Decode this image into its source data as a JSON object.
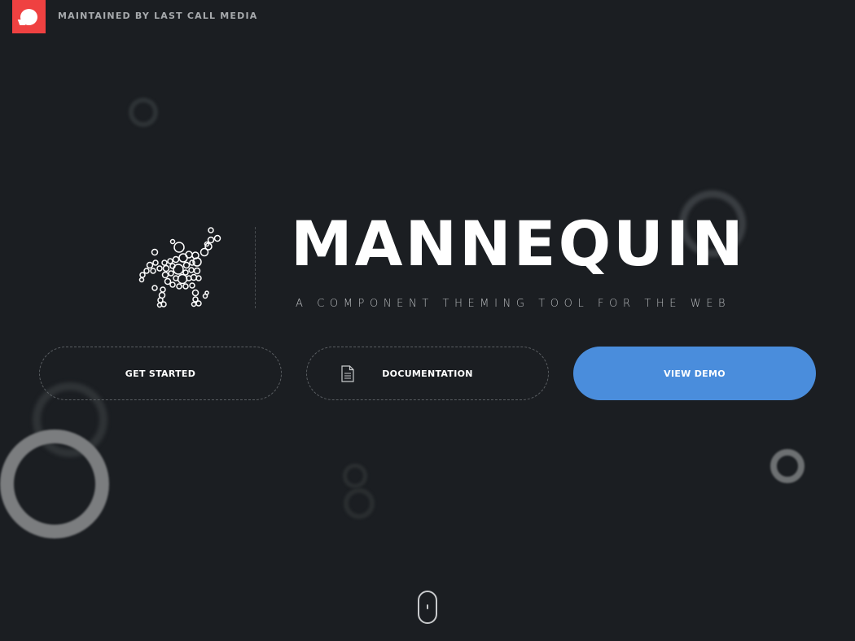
{
  "header": {
    "maintained_label": "MAINTAINED BY LAST CALL MEDIA",
    "brand_color": "#ef4141"
  },
  "hero": {
    "title": "MANNEQUIN",
    "subtitle": "A COMPONENT THEMING TOOL FOR THE WEB",
    "logo_icon": "mannequin-bubbles-logo"
  },
  "actions": {
    "get_started_label": "GET STARTED",
    "documentation_label": "DOCUMENTATION",
    "documentation_icon": "document-icon",
    "view_demo_label": "VIEW DEMO",
    "accent_color": "#4a8ddc"
  },
  "scroll": {
    "icon": "mouse-scroll-icon"
  },
  "colors": {
    "background": "#1b1e22",
    "text": "#ffffff",
    "muted_text": "#a7aaad"
  }
}
